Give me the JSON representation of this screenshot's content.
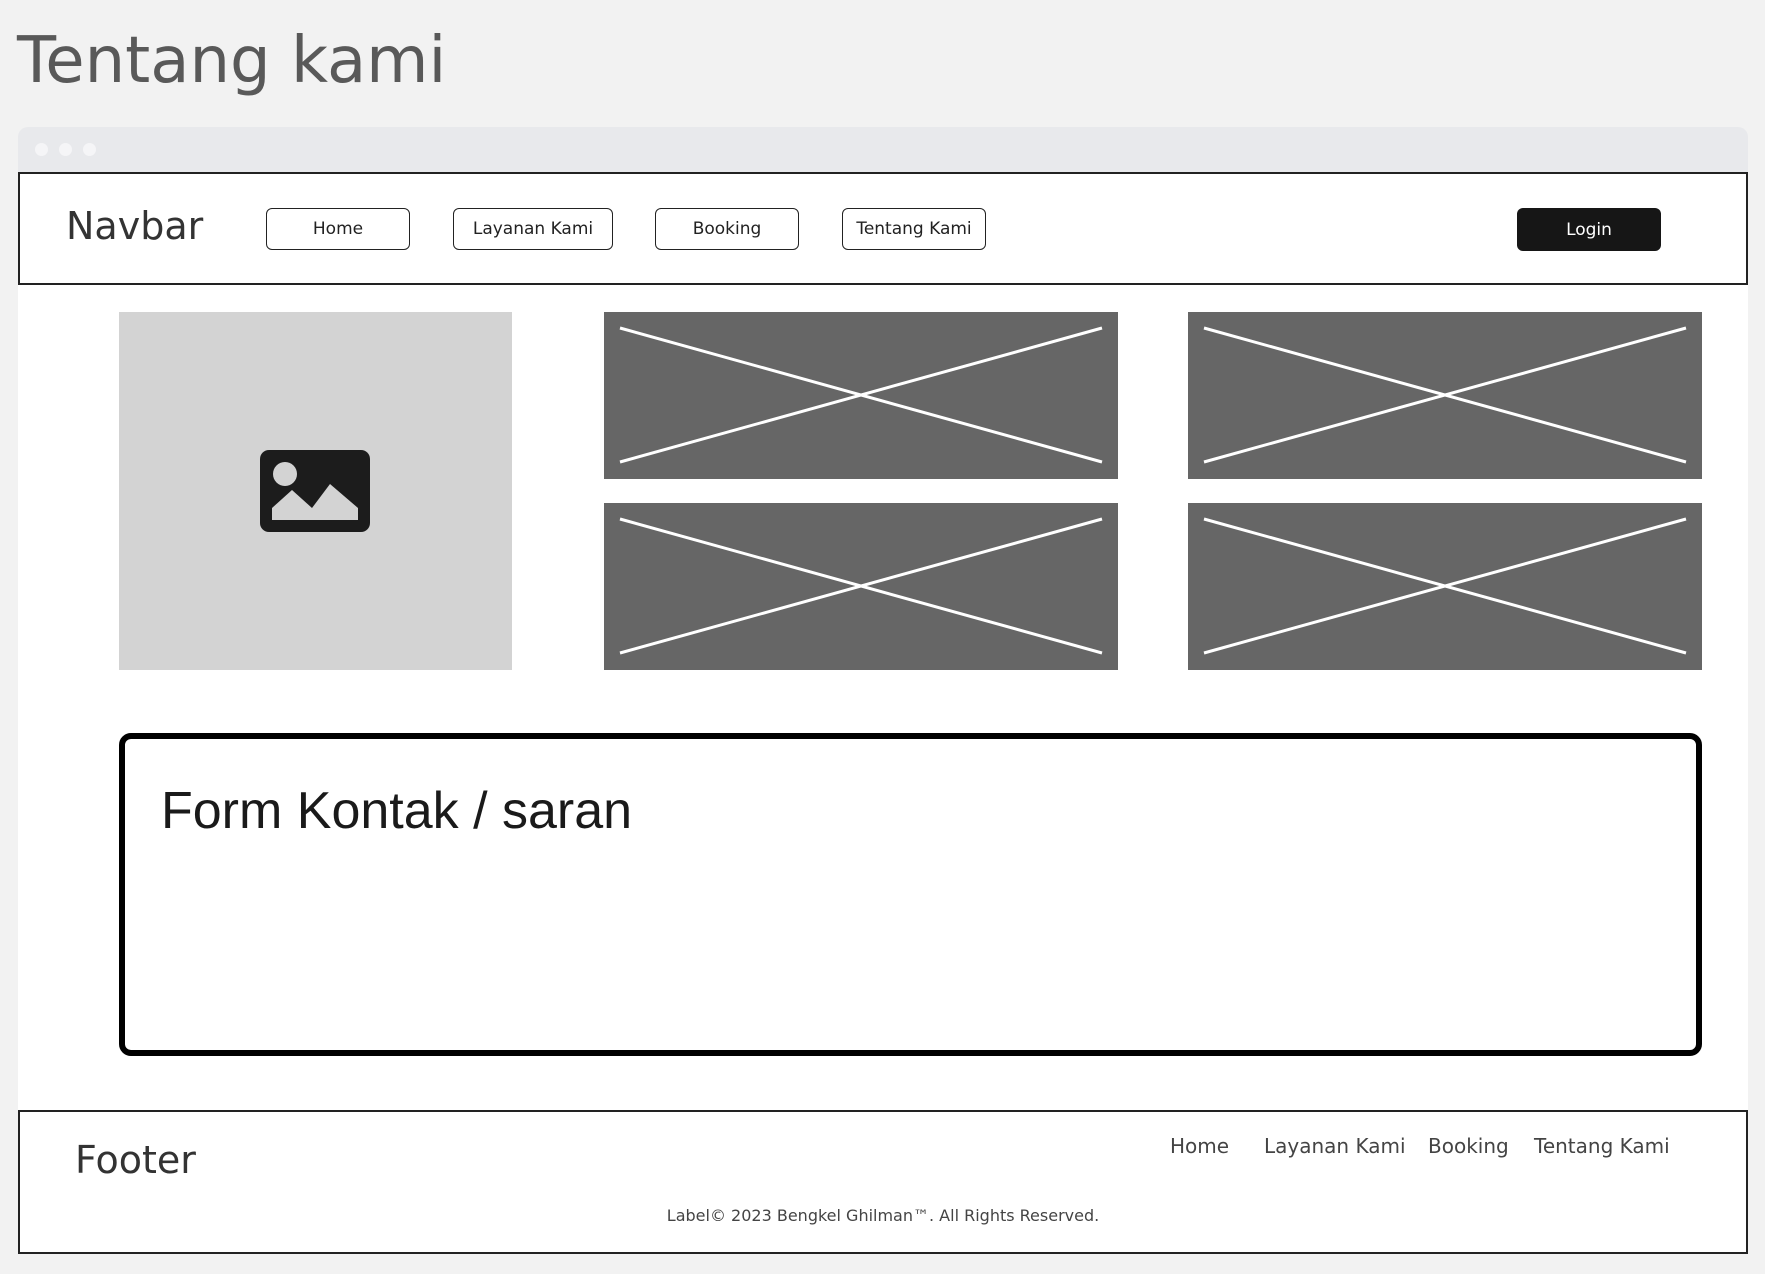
{
  "page": {
    "title": "Tentang kami"
  },
  "navbar": {
    "brand": "Navbar",
    "items": [
      {
        "label": "Home"
      },
      {
        "label": "Layanan Kami"
      },
      {
        "label": "Booking"
      },
      {
        "label": "Tentang Kami"
      }
    ],
    "login_label": "Login"
  },
  "hero": {
    "image_icon": "image-icon"
  },
  "form": {
    "title": "Form Kontak / saran"
  },
  "footer": {
    "brand": "Footer",
    "links": [
      {
        "label": "Home"
      },
      {
        "label": "Layanan Kami"
      },
      {
        "label": "Booking"
      },
      {
        "label": "Tentang Kami"
      }
    ],
    "copyright": "Label© 2023 Bengkel Ghilman™. All Rights Reserved."
  },
  "colors": {
    "background": "#f2f2f2",
    "placeholder_dark": "#666666",
    "placeholder_light": "#d3d3d3",
    "login_bg": "#161616"
  }
}
